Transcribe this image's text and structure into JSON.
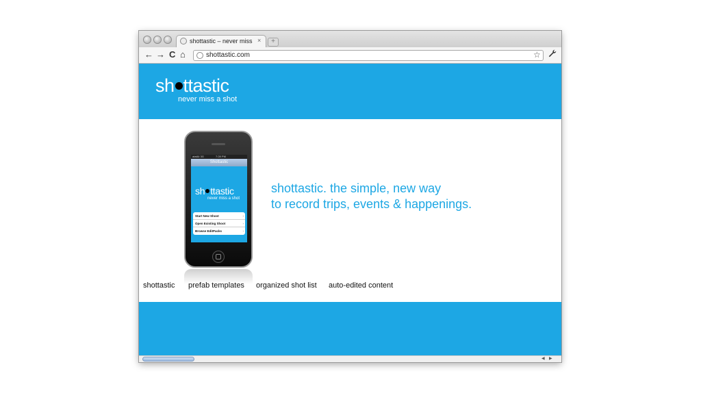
{
  "browser": {
    "tab_title": "shottastic – never miss a sho",
    "tab_close": "×",
    "new_tab": "+",
    "url": "shottastic.com",
    "nav": {
      "back": "←",
      "forward": "→",
      "reload": "C",
      "home": "⌂"
    },
    "bookmark_star": "☆",
    "wrench": "🔧"
  },
  "header": {
    "logo_pre": "sh",
    "logo_post": "ttastic",
    "tagline": "never miss a shot"
  },
  "phone": {
    "carrier": "atat&t 3G",
    "time": "7:28 PM",
    "nav_title": "Shottastic",
    "logo_pre": "sh",
    "logo_post": "ttastic",
    "tagline": "never miss a shot",
    "menu": [
      {
        "label": "Start New Shoot"
      },
      {
        "label": "Open Existing Shoot"
      },
      {
        "label": "Browse EditPacks"
      }
    ],
    "chevron": "›"
  },
  "hero": {
    "line1": "shottastic. the simple, new way",
    "line2": "to record trips, events & happenings."
  },
  "nav_links": [
    "shottastic",
    "prefab templates",
    "organized shot list",
    "auto-edited content"
  ],
  "colors": {
    "brand_blue": "#1da7e4",
    "chrome_gray": "#dcdcdc"
  }
}
